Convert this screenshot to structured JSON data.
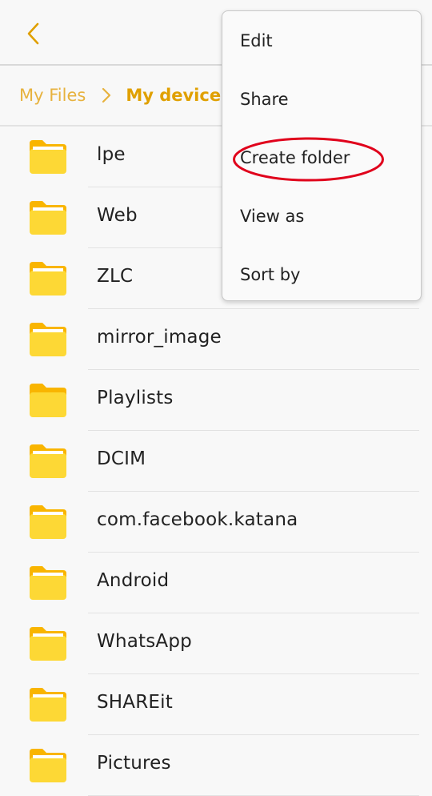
{
  "app_bar": {
    "back_icon": "chevron-left-icon",
    "accent_color": "#e0a000"
  },
  "breadcrumb": {
    "items": [
      "My Files",
      "My device"
    ],
    "separator_icon": "chevron-right-icon"
  },
  "folders": [
    {
      "name": "lpe",
      "icon": "folder-icon"
    },
    {
      "name": "Web",
      "icon": "folder-icon"
    },
    {
      "name": "ZLC",
      "icon": "folder-icon"
    },
    {
      "name": "mirror_image",
      "icon": "folder-icon"
    },
    {
      "name": "Playlists",
      "icon": "folder-icon"
    },
    {
      "name": "DCIM",
      "icon": "folder-icon"
    },
    {
      "name": "com.facebook.katana",
      "icon": "folder-icon"
    },
    {
      "name": "Android",
      "icon": "folder-icon"
    },
    {
      "name": "WhatsApp",
      "icon": "folder-icon"
    },
    {
      "name": "SHAREit",
      "icon": "folder-icon"
    },
    {
      "name": "Pictures",
      "icon": "folder-icon"
    }
  ],
  "menu": {
    "items": [
      "Edit",
      "Share",
      "Create folder",
      "View as",
      "Sort by"
    ],
    "highlighted_item": "Create folder",
    "highlight_color": "#e0001b"
  },
  "colors": {
    "folder_body": "#fdd835",
    "folder_tab": "#f9b500"
  }
}
